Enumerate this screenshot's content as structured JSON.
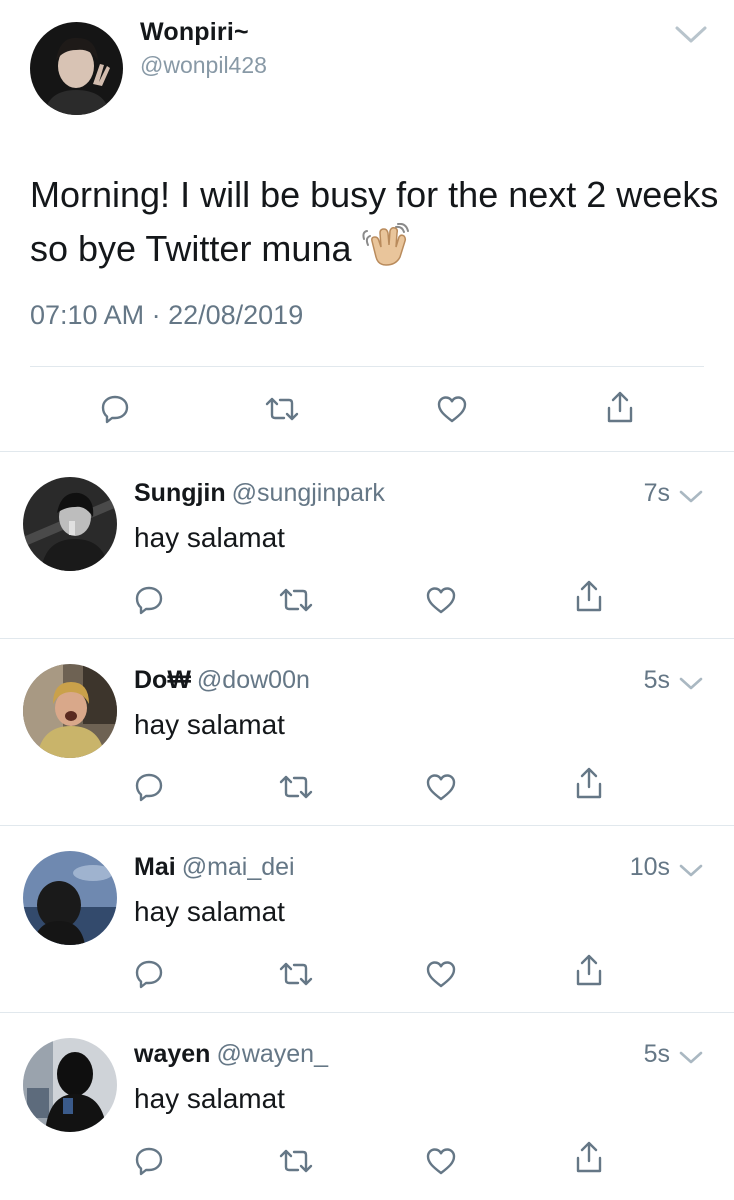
{
  "main": {
    "display_name": "Wonpiri~",
    "handle": "@wonpil428",
    "text": "Morning! I will be busy for the next 2 weeks so bye Twitter muna",
    "emoji": "waving-hand-emoji",
    "time": "07:10 AM",
    "date": "22/08/2019"
  },
  "replies": [
    {
      "name": "Sungjin",
      "handle": "@sungjinpark",
      "time": "7s",
      "text": "hay salamat"
    },
    {
      "name": "Do₩",
      "handle": "@dow00n",
      "time": "5s",
      "text": "hay salamat"
    },
    {
      "name": "Mai",
      "handle": "@mai_dei",
      "time": "10s",
      "text": "hay salamat"
    },
    {
      "name": "wayen",
      "handle": "@wayen_",
      "time": "5s",
      "text": "hay salamat"
    }
  ],
  "colors": {
    "text": "#14171a",
    "secondary": "#657786",
    "handle": "#8899a6",
    "divider": "#e1e8ed"
  }
}
